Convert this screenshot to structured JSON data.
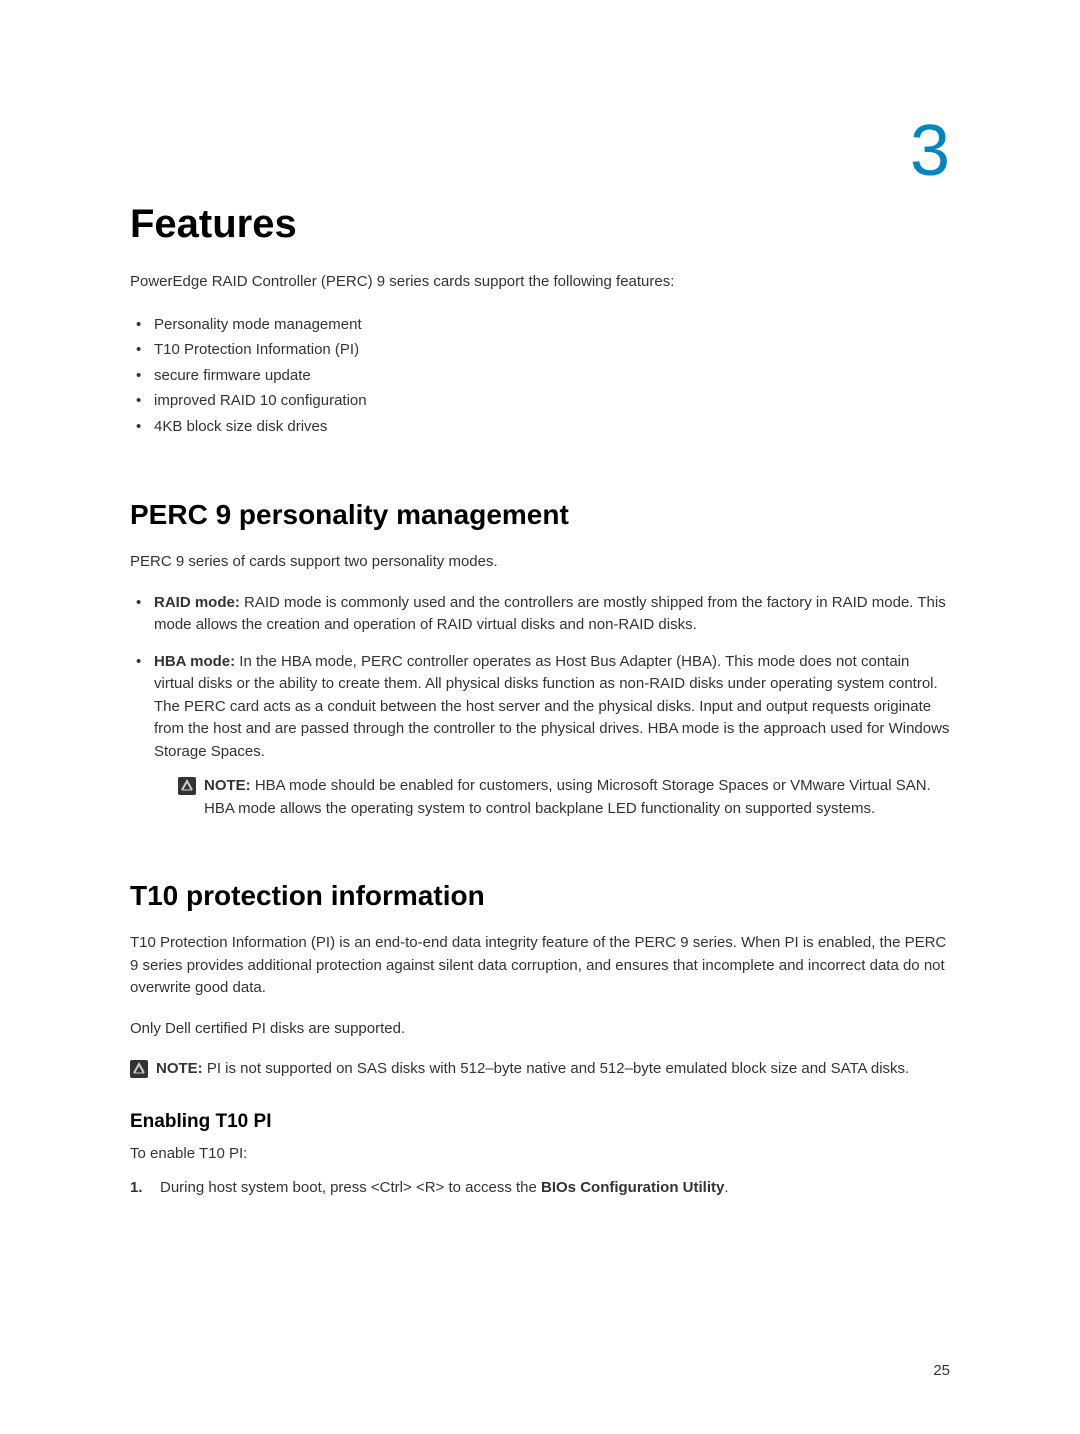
{
  "chapter_number": "3",
  "title": "Features",
  "intro": "PowerEdge RAID Controller (PERC) 9 series cards support the following features:",
  "feature_bullets": [
    "Personality mode management",
    "T10 Protection Information (PI)",
    "secure firmware update",
    "improved RAID 10 configuration",
    "4KB block size disk drives"
  ],
  "section1": {
    "heading": "PERC 9 personality management",
    "intro": "PERC 9 series of cards support two personality modes.",
    "modes": [
      {
        "label": "RAID mode:",
        "text": " RAID mode is commonly used and the controllers are mostly shipped from the factory in RAID mode. This mode allows the creation and operation of RAID virtual disks and non-RAID disks."
      },
      {
        "label": "HBA mode:",
        "text": " In the HBA mode, PERC controller operates as Host Bus Adapter (HBA). This mode does not contain virtual disks or the ability to create them. All physical disks function as non-RAID disks under operating system control. The PERC card acts as a conduit between the host server and the physical disks. Input and output requests originate from the host and are passed through the controller to the physical drives. HBA mode is the approach used for Windows Storage Spaces."
      }
    ],
    "note": {
      "label": "NOTE:",
      "text": " HBA mode should be enabled for customers, using Microsoft Storage Spaces or VMware Virtual SAN.  HBA mode allows the operating system to control backplane LED functionality on supported systems."
    }
  },
  "section2": {
    "heading": "T10 protection information",
    "para1": "T10 Protection Information (PI) is an end-to-end data integrity feature of the PERC 9 series. When PI is enabled, the PERC 9 series provides additional protection against silent data corruption, and ensures that incomplete and incorrect data do not overwrite good data.",
    "para2": "Only Dell certified PI disks are supported.",
    "note": {
      "label": "NOTE:",
      "text": " PI is not supported on SAS disks with 512–byte native and 512–byte emulated block size and SATA disks."
    },
    "subsection": {
      "heading": "Enabling T10 PI",
      "intro": "To enable T10 PI:",
      "step1_prefix": "During host system boot, press <Ctrl> <R> to access the ",
      "step1_bold": "BIOs Configuration Utility",
      "step1_suffix": "."
    }
  },
  "page_number": "25"
}
